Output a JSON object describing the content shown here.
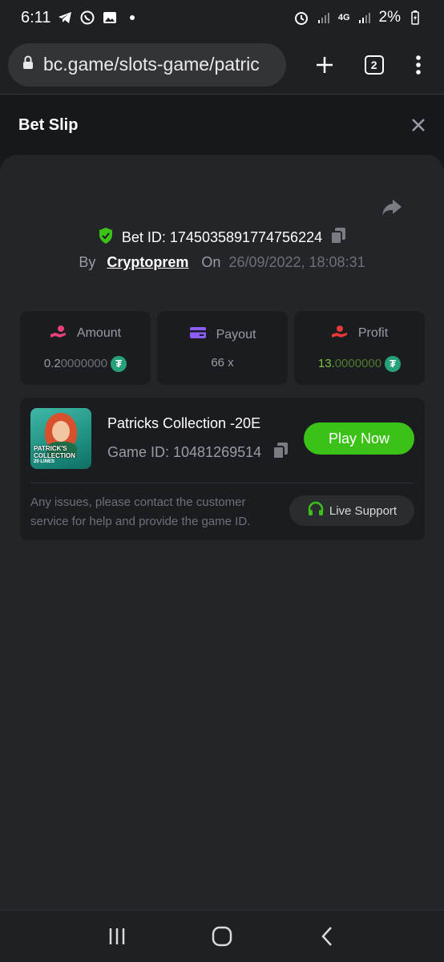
{
  "status_bar": {
    "time": "6:11",
    "network": "4G",
    "battery": "2%"
  },
  "browser": {
    "url": "bc.game/slots-game/patric",
    "tab_count": "2"
  },
  "header": {
    "title": "Bet Slip"
  },
  "bet": {
    "id_label": "Bet ID: 1745035891774756224",
    "by_label": "By",
    "user": "Cryptoprem",
    "on_label": "On",
    "date": "26/09/2022, 18:08:31"
  },
  "stats": [
    {
      "label": "Amount",
      "value_main": "0.2",
      "value_dim": "0000000",
      "icon": "amount-icon",
      "color": "#e8407a"
    },
    {
      "label": "Payout",
      "value_main": "66 x",
      "value_dim": "",
      "icon": "card-icon",
      "color": "#8b5cf6"
    },
    {
      "label": "Profit",
      "value_main": "13.",
      "value_dim": "0000000",
      "icon": "profit-icon",
      "color": "#e53935"
    }
  ],
  "game": {
    "title": "Patricks Collection -20E",
    "id_label": "Game ID: 10481269514",
    "thumb_line1": "PATRICK'S",
    "thumb_line2": "COLLECTION",
    "thumb_line3": "20 LINES",
    "play_label": "Play Now",
    "issues_text": "Any issues, please contact the customer service for help and provide the game ID.",
    "support_label": "Live Support"
  },
  "colors": {
    "play": "#3bc117",
    "profit_green": "#7fc23a",
    "tether": "#26a17b",
    "shield": "#3bc117"
  }
}
